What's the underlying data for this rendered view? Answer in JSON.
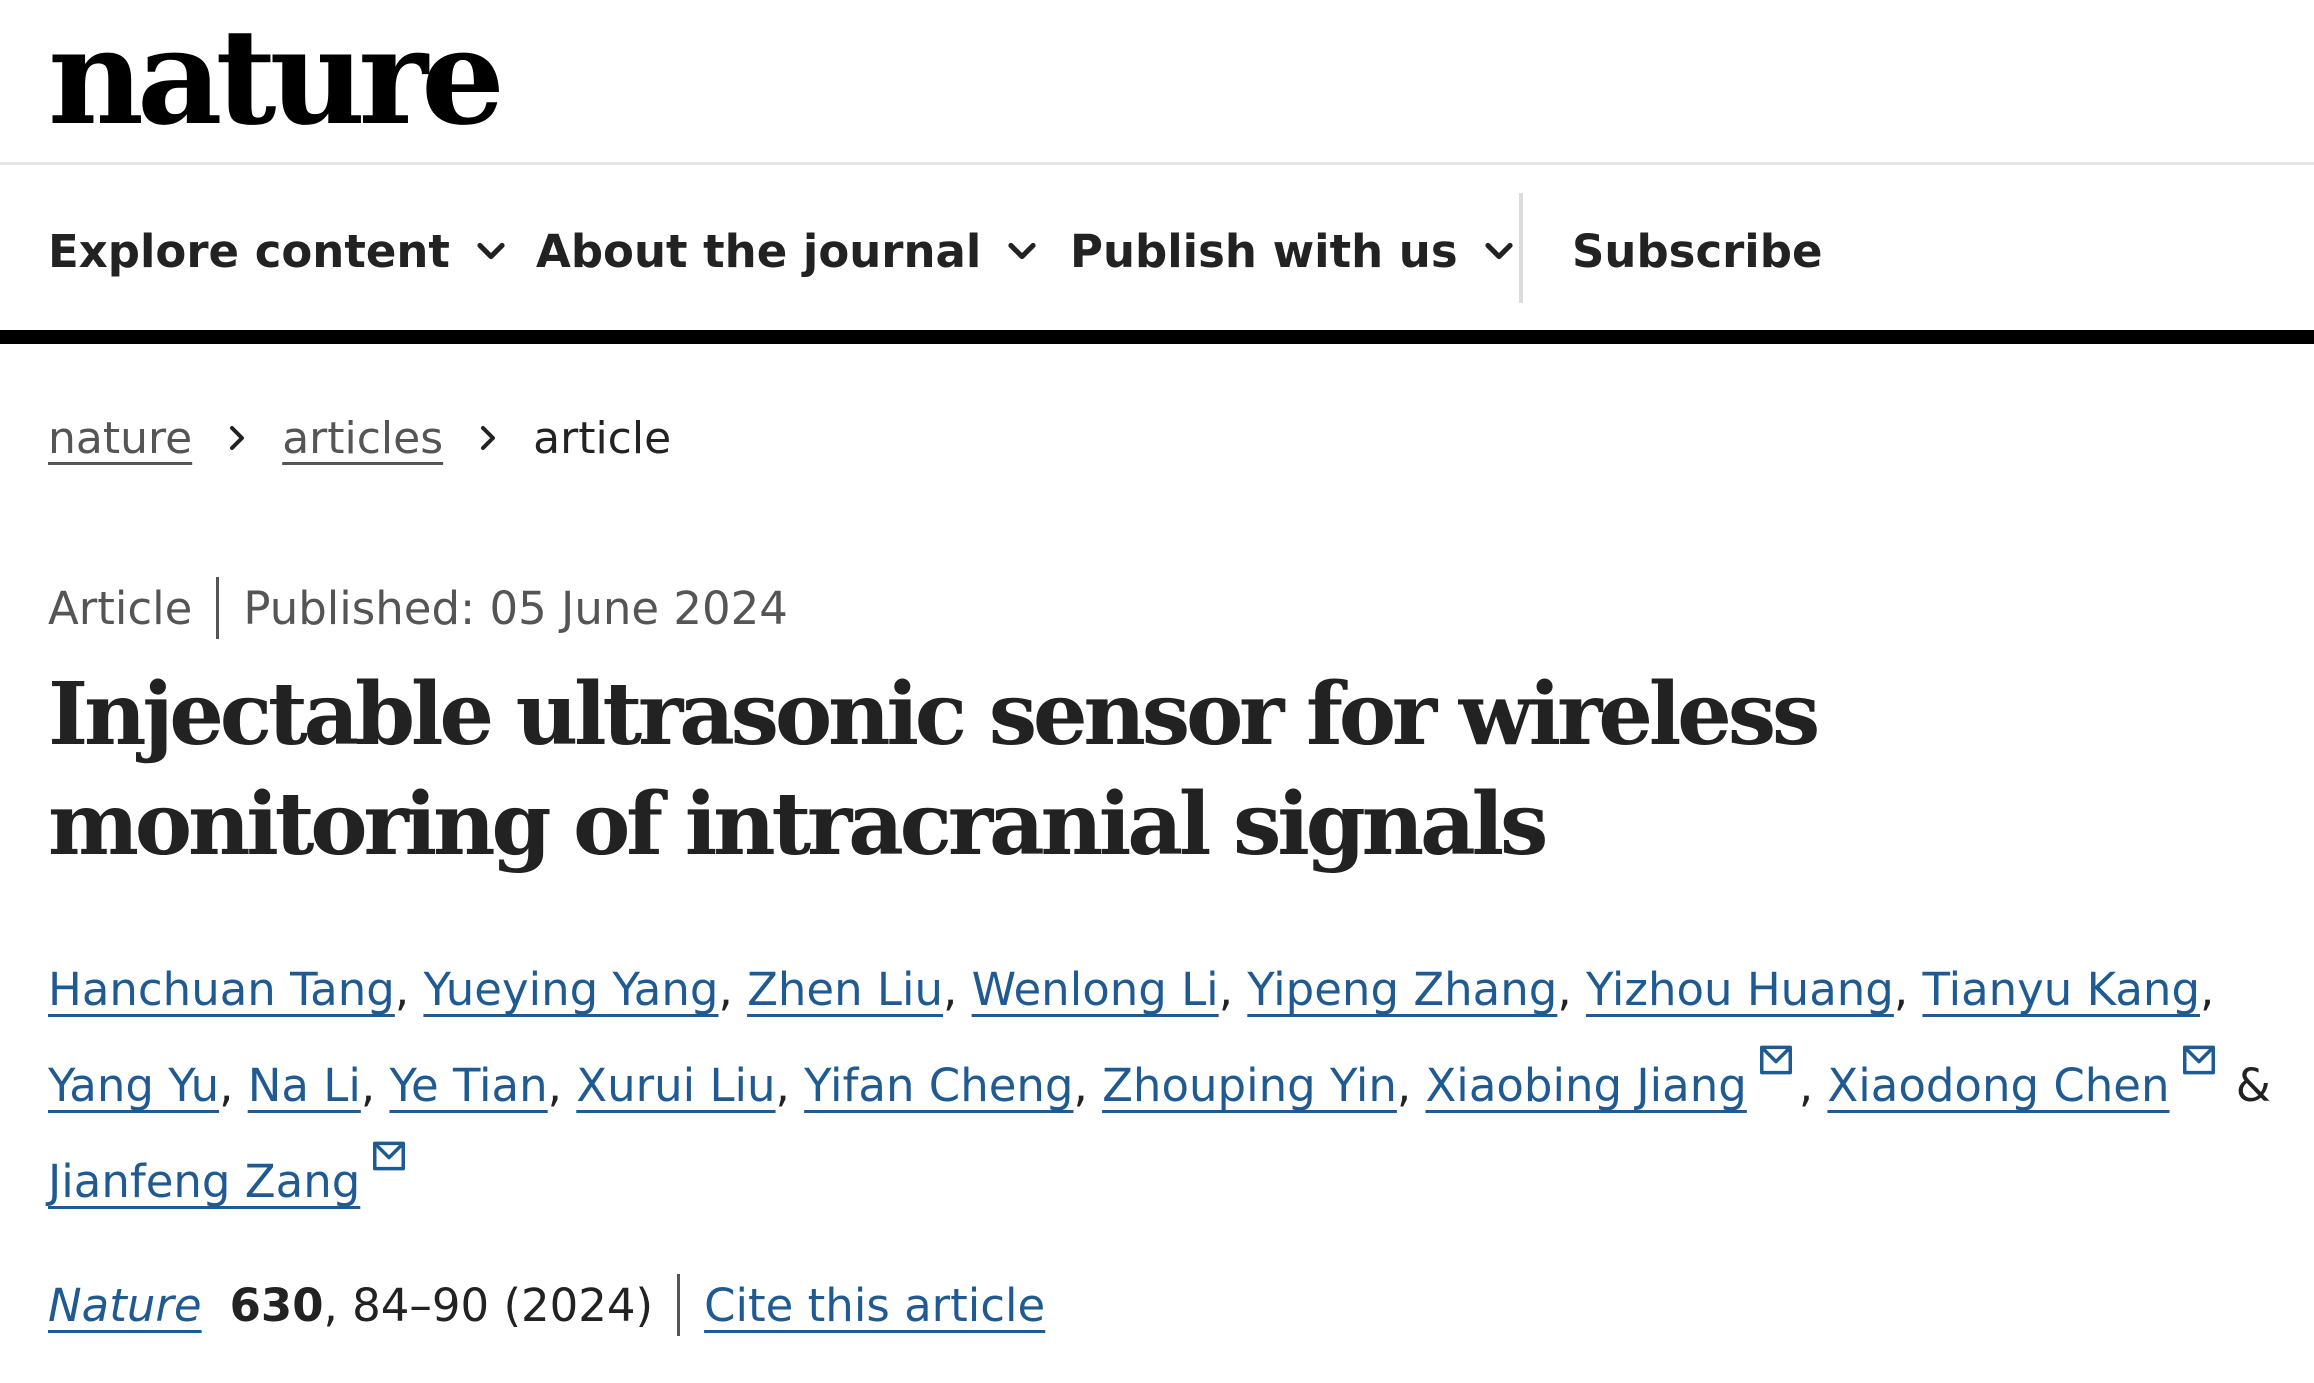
{
  "header": {
    "logo_text": "nature"
  },
  "nav": {
    "items": [
      {
        "label": "Explore content",
        "icon": "chevron-down-icon"
      },
      {
        "label": "About the journal",
        "icon": "chevron-down-icon"
      },
      {
        "label": "Publish with us",
        "icon": "chevron-down-icon"
      },
      {
        "label": "Subscribe"
      }
    ]
  },
  "breadcrumb": {
    "items": [
      "nature",
      "articles",
      "article"
    ],
    "separator_icon": "chevron-right-icon"
  },
  "article": {
    "type": "Article",
    "published": "Published: 05 June 2024",
    "title": "Injectable ultrasonic sensor for wireless monitoring of intracranial signals",
    "authors": [
      "Hanchuan Tang",
      "Yueying Yang",
      "Zhen Liu",
      "Wenlong Li",
      "Yipeng Zhang",
      "Yizhou Huang",
      "Tianyu Kang",
      "Yang Yu",
      "Na Li",
      "Ye Tian",
      "Xurui Liu",
      "Yifan Cheng",
      "Zhouping Yin",
      "Xiaobing Jiang",
      "Xiaodong Chen",
      "Jianfeng Zang"
    ],
    "corresponding_icon": "mail-icon",
    "author_sep": ", ",
    "author_last_sep": " & ",
    "citation": {
      "journal": "Nature",
      "volume": "630",
      "pages_year": ", 84–90 (2024)",
      "cite_label": "Cite this article"
    }
  },
  "colors": {
    "link": "#1f5b92",
    "text": "#222222",
    "muted": "#555555",
    "rule": "#000000"
  }
}
